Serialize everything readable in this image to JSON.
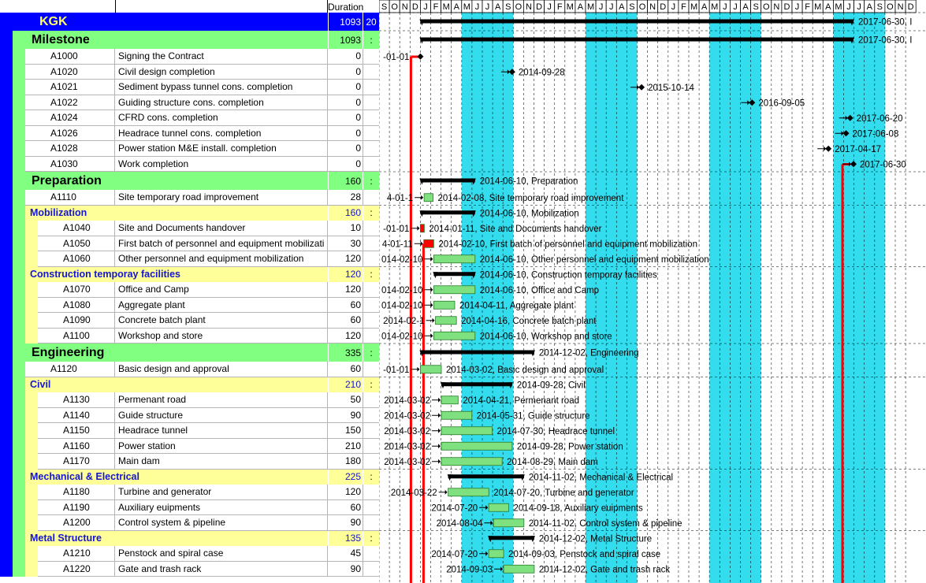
{
  "header": {
    "duration_label": "Duration"
  },
  "timescale": {
    "months": [
      "S",
      "O",
      "N",
      "D",
      "J",
      "F",
      "M",
      "A",
      "M",
      "J",
      "J",
      "A",
      "S",
      "O",
      "N",
      "D",
      "J",
      "F",
      "M",
      "A",
      "M",
      "J",
      "J",
      "A",
      "S",
      "O",
      "N",
      "D",
      "J",
      "F",
      "M",
      "A",
      "M",
      "J",
      "J",
      "A",
      "S",
      "O",
      "N",
      "D",
      "J",
      "F",
      "M",
      "A",
      "M",
      "J",
      "J",
      "A",
      "S",
      "O",
      "N",
      "D"
    ]
  },
  "colors": {
    "project": "#0000ff",
    "wbs1": "#80ff80",
    "wbs2": "#ffff99",
    "summary_bar": "#000000",
    "task_bar": "#7fe07f",
    "critical": "#ff0000",
    "shade": "#33ddee"
  },
  "rows": [
    {
      "type": "wbs0",
      "name": "KGK",
      "duration": "1093",
      "cal": "20",
      "label": "2017-06-30, I"
    },
    {
      "type": "wbs1",
      "name": "Milestone",
      "duration": "1093",
      "cal": ":",
      "label": "2017-06-30, I"
    },
    {
      "type": "act",
      "id": "A1000",
      "name": "Signing the Contract",
      "duration": "0",
      "left": "-01-01"
    },
    {
      "type": "act",
      "id": "A1020",
      "name": "Civil design completion",
      "duration": "0",
      "label": "2014-09-28"
    },
    {
      "type": "act",
      "id": "A1021",
      "name": "Sediment bypass tunnel cons. completion",
      "duration": "0",
      "label": "2015-10-14"
    },
    {
      "type": "act",
      "id": "A1022",
      "name": "Guiding structure cons. completion",
      "duration": "0",
      "label": "2016-09-05"
    },
    {
      "type": "act",
      "id": "A1024",
      "name": "CFRD cons. completion",
      "duration": "0",
      "label": "2017-06-20"
    },
    {
      "type": "act",
      "id": "A1026",
      "name": "Headrace tunnel cons. completion",
      "duration": "0",
      "label": "2017-06-08"
    },
    {
      "type": "act",
      "id": "A1028",
      "name": "Power station M&E install. completion",
      "duration": "0",
      "label": "2017-04-17"
    },
    {
      "type": "act",
      "id": "A1030",
      "name": "Work completion",
      "duration": "0",
      "label": "2017-06-30"
    },
    {
      "type": "wbs1",
      "name": "Preparation",
      "duration": "160",
      "cal": ":",
      "label": "2014-06-10, Preparation"
    },
    {
      "type": "act",
      "id": "A1110",
      "name": "Site temporary road improvement",
      "duration": "28",
      "left": "4-01-1",
      "label": "2014-02-08, Site temporary road improvement"
    },
    {
      "type": "wbs2",
      "name": "Mobilization",
      "duration": "160",
      "cal": ":",
      "label": "2014-06-10, Mobilization"
    },
    {
      "type": "act",
      "id": "A1040",
      "name": "Site and Documents handover",
      "duration": "10",
      "left": "-01-01",
      "label": "2014-01-11, Site and Documents handover"
    },
    {
      "type": "act",
      "id": "A1050",
      "name": "First batch of personnel and equipment mobilizati",
      "duration": "30",
      "left": "4-01-11",
      "label": "2014-02-10, First batch of personnel and equipment mobilization"
    },
    {
      "type": "act",
      "id": "A1060",
      "name": "Other personnel and equipment mobilization",
      "duration": "120",
      "left": "014-02-10",
      "label": "2014-06-10, Other personnel and equipment mobilization"
    },
    {
      "type": "wbs2",
      "name": "Construction temporay facilities",
      "duration": "120",
      "cal": ":",
      "label": "2014-06-10, Construction temporay facilities"
    },
    {
      "type": "act",
      "id": "A1070",
      "name": "Office and Camp",
      "duration": "120",
      "left": "014-02-10",
      "label": "2014-06-10, Office and Camp"
    },
    {
      "type": "act",
      "id": "A1080",
      "name": "Aggregate plant",
      "duration": "60",
      "left": "014-02-10",
      "label": "2014-04-11, Aggregate plant"
    },
    {
      "type": "act",
      "id": "A1090",
      "name": "Concrete batch plant",
      "duration": "60",
      "left": "2014-02-1",
      "label": "2014-04-16, Concrete batch plant"
    },
    {
      "type": "act",
      "id": "A1100",
      "name": "Workshop and store",
      "duration": "120",
      "left": "014-02-10",
      "label": "2014-06-10, Workshop and store"
    },
    {
      "type": "wbs1",
      "name": "Engineering",
      "duration": "335",
      "cal": ":",
      "label": "2014-12-02, Engineering"
    },
    {
      "type": "act",
      "id": "A1120",
      "name": "Basic design and approval",
      "duration": "60",
      "left": "-01-01",
      "label": "2014-03-02, Basic design and approval"
    },
    {
      "type": "wbs2",
      "name": "Civil",
      "duration": "210",
      "cal": ":",
      "label": "2014-09-28, Civil"
    },
    {
      "type": "act",
      "id": "A1130",
      "name": "Permenant road",
      "duration": "50",
      "left": "2014-03-02",
      "label": "2014-04-21, Permenant road"
    },
    {
      "type": "act",
      "id": "A1140",
      "name": "Guide structure",
      "duration": "90",
      "left": "2014-03-02",
      "label": "2014-05-31, Guide structure"
    },
    {
      "type": "act",
      "id": "A1150",
      "name": "Headrace tunnel",
      "duration": "150",
      "left": "2014-03-02",
      "label": "2014-07-30, Headrace tunnel"
    },
    {
      "type": "act",
      "id": "A1160",
      "name": "Power station",
      "duration": "210",
      "left": "2014-03-02",
      "label": "2014-09-28, Power station"
    },
    {
      "type": "act",
      "id": "A1170",
      "name": "Main dam",
      "duration": "180",
      "left": "2014-03-02",
      "label": "2014-08-29, Main dam"
    },
    {
      "type": "wbs2",
      "name": "Mechanical & Electrical",
      "duration": "225",
      "cal": ":",
      "label": "2014-11-02, Mechanical & Electrical"
    },
    {
      "type": "act",
      "id": "A1180",
      "name": "Turbine and generator",
      "duration": "120",
      "left": "2014-03-22",
      "label": "2014-07-20, Turbine and generator"
    },
    {
      "type": "act",
      "id": "A1190",
      "name": "Auxiliary euipments",
      "duration": "60",
      "left": "2014-07-20",
      "label": "2014-09-18, Auxiliary euipments"
    },
    {
      "type": "act",
      "id": "A1200",
      "name": "Control system & pipeline",
      "duration": "90",
      "left": "2014-08-04",
      "label": "2014-11-02, Control system & pipeline"
    },
    {
      "type": "wbs2",
      "name": "Metal Structure",
      "duration": "135",
      "cal": ":",
      "label": "2014-12-02, Metal Structure"
    },
    {
      "type": "act",
      "id": "A1210",
      "name": "Penstock and spiral case",
      "duration": "45",
      "left": "2014-07-20",
      "label": "2014-09-03, Penstock and spiral case"
    },
    {
      "type": "act",
      "id": "A1220",
      "name": "Gate and trash rack",
      "duration": "90",
      "left": "2014-09-03",
      "label": "2014-12-02, Gate and trash rack"
    }
  ]
}
